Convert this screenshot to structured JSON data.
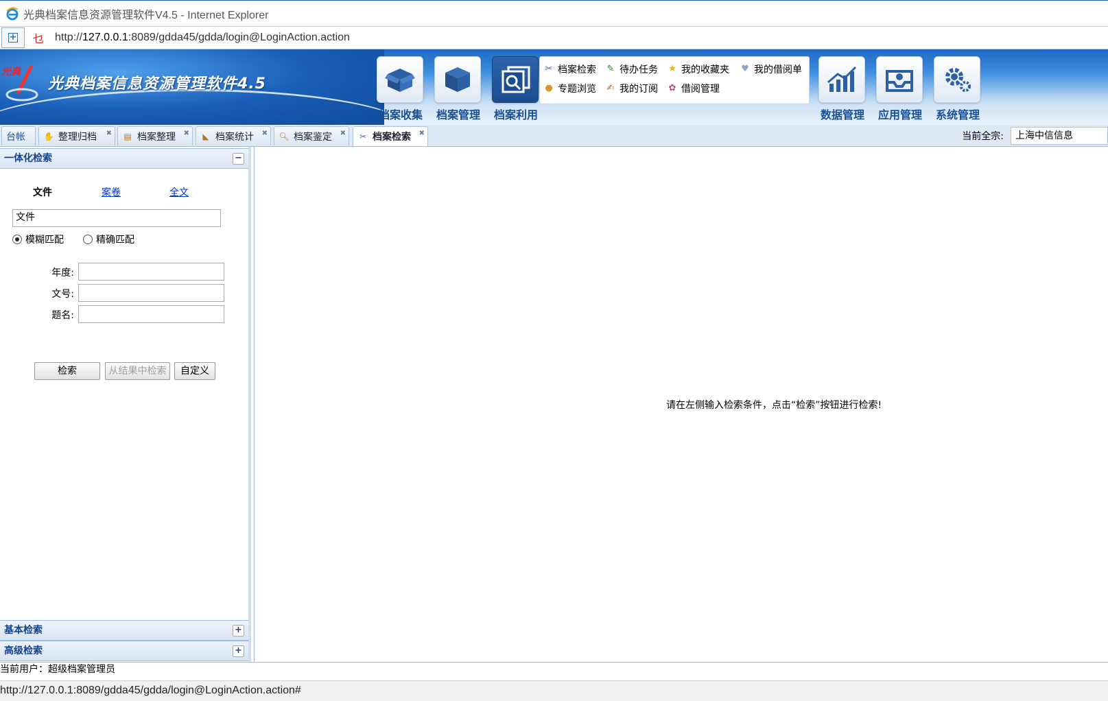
{
  "window": {
    "title": "光典档案信息资源管理软件V4.5 - Internet Explorer"
  },
  "address": {
    "url_prefix": "http://",
    "url_host": "127.0.0.1",
    "url_rest": ":8089/gdda45/gdda/login@LoginAction.action"
  },
  "app": {
    "brand_small": "光典",
    "title": "光典档案信息资源管理软件4.5",
    "modules": [
      {
        "label": "档案收集",
        "icon": "open-box-icon"
      },
      {
        "label": "档案管理",
        "icon": "box-icon"
      },
      {
        "label": "档案利用",
        "icon": "document-search-icon",
        "active": true
      },
      {
        "label": "数据管理",
        "icon": "chart-icon"
      },
      {
        "label": "应用管理",
        "icon": "inbox-gear-icon"
      },
      {
        "label": "系统管理",
        "icon": "gears-icon"
      }
    ],
    "quick_links": [
      {
        "label": "档案检索",
        "icon": "search-tools-icon"
      },
      {
        "label": "待办任务",
        "icon": "pen-paper-icon"
      },
      {
        "label": "我的收藏夹",
        "icon": "star-icon"
      },
      {
        "label": "我的借阅单",
        "icon": "note-icon"
      },
      {
        "label": "专题浏览",
        "icon": "user-icon"
      },
      {
        "label": "我的订阅",
        "icon": "pen-icon"
      },
      {
        "label": "借阅管理",
        "icon": "palette-icon"
      }
    ]
  },
  "tabs": [
    {
      "label": "台帐"
    },
    {
      "label": "整理归档"
    },
    {
      "label": "档案整理"
    },
    {
      "label": "档案统计"
    },
    {
      "label": "档案鉴定"
    },
    {
      "label": "档案检索",
      "active": true
    }
  ],
  "fonds": {
    "label": "当前全宗:",
    "value": "上海中信信息"
  },
  "left": {
    "section1": "一体化检索",
    "search_tabs": {
      "file": "文件",
      "volume": "案卷",
      "fulltext": "全文"
    },
    "type_value": "文件",
    "match": {
      "fuzzy": "模糊匹配",
      "exact": "精确匹配",
      "selected": "fuzzy"
    },
    "fields": {
      "year": "年度:",
      "docno": "文号:",
      "title": "题名:"
    },
    "buttons": {
      "search": "检索",
      "search_in_results": "从结果中检索",
      "custom": "自定义"
    },
    "section2": "基本检索",
    "section3": "高级检索"
  },
  "main": {
    "hint": "请在左侧输入检索条件，点击“检索”按钮进行检索!"
  },
  "footer": {
    "user": "当前用户：超级档案管理员",
    "status_url": "http://127.0.0.1:8089/gdda45/gdda/login@LoginAction.action#"
  },
  "colors": {
    "accent": "#15428b",
    "header_blue": "#1f69c4",
    "panel_border": "#99bbe8"
  }
}
